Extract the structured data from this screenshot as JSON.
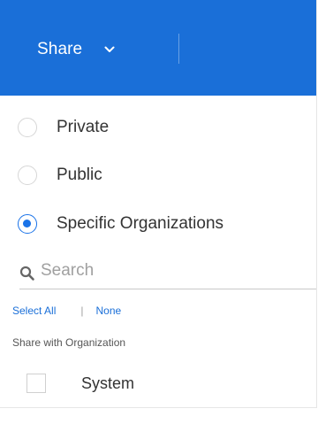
{
  "header": {
    "share_label": "Share",
    "share_icon": "chevron-down-icon",
    "background_color": "#1a6fd8"
  },
  "visibility": {
    "options": [
      {
        "label": "Private",
        "selected": false
      },
      {
        "label": "Public",
        "selected": false
      },
      {
        "label": "Specific Organizations",
        "selected": true
      }
    ]
  },
  "search": {
    "placeholder": "Search",
    "value": "",
    "icon": "search-icon"
  },
  "selection_links": {
    "select_all": "Select All",
    "separator": "|",
    "none": "None"
  },
  "organizations": {
    "caption": "Share with Organization",
    "items": [
      {
        "label": "System",
        "checked": false
      }
    ]
  },
  "colors": {
    "accent": "#1a73e8",
    "link": "#1a6fd8"
  }
}
